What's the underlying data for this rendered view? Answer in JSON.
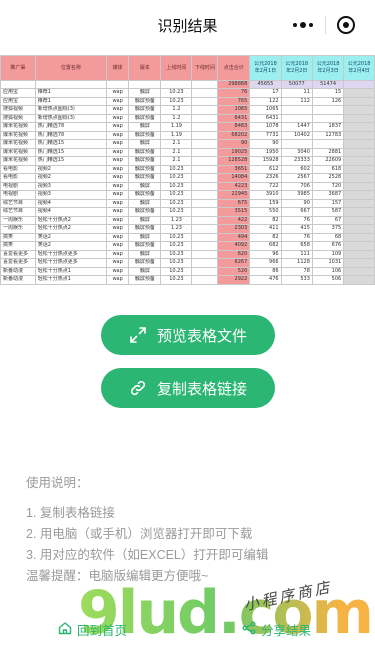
{
  "nav": {
    "title": "识别结果"
  },
  "sheet": {
    "headers": [
      "推广渠",
      "位置名称",
      "媒体",
      "版本",
      "上线时间",
      "下线时间",
      "点击合计",
      "公元2018年2月1日",
      "公元2018年2月2日",
      "公元2018年2月3日",
      "公元2018年2月4日"
    ],
    "totals": [
      "",
      "",
      "",
      "",
      "",
      "",
      "298868",
      "45655",
      "50077",
      "51474",
      ""
    ],
    "rows": [
      [
        "应用宝",
        "推荐1",
        "wap",
        "触屏",
        "10.23",
        "",
        "76",
        "17",
        "11",
        "15",
        ""
      ],
      [
        "应用宝",
        "推荐1",
        "wap",
        "触屏预备",
        "10.23",
        "",
        "765",
        "122",
        "112",
        "126",
        ""
      ],
      [
        "搜狐视频",
        "新增热点图标(3)",
        "wap",
        "触屏预备",
        "1.2",
        "",
        "1065",
        "1065",
        "",
        "",
        ""
      ],
      [
        "搜狐视频",
        "新增热点图标(3)",
        "wap",
        "触屏预备",
        "1.2",
        "",
        "6431",
        "6431",
        "",
        "",
        ""
      ],
      [
        "爆米花视频",
        "热门精选78",
        "wap",
        "触屏",
        "1.19",
        "",
        "8483",
        "1078",
        "1447",
        "1837",
        ""
      ],
      [
        "爆米花视频",
        "热门精选78",
        "wap",
        "触屏预备",
        "1.19",
        "",
        "68202",
        "7731",
        "10402",
        "12783",
        ""
      ],
      [
        "爆米花视频",
        "热门精选15",
        "wap",
        "触屏",
        "2.1",
        "",
        "90",
        "90",
        "",
        "",
        ""
      ],
      [
        "爆米花视频",
        "热门精选15",
        "wap",
        "触屏预备",
        "2.1",
        "",
        "19025",
        "1950",
        "3040",
        "2881",
        ""
      ],
      [
        "爆米花视频",
        "热门精选15",
        "wap",
        "触屏预备",
        "2.1",
        "",
        "128528",
        "15928",
        "23333",
        "22609",
        ""
      ],
      [
        "看电影",
        "视频2",
        "wap",
        "触屏预备",
        "10.23",
        "",
        "3651",
        "612",
        "602",
        "618",
        ""
      ],
      [
        "看电影",
        "视频2",
        "wap",
        "触屏预备",
        "10.23",
        "",
        "14084",
        "2326",
        "2567",
        "2528",
        ""
      ],
      [
        "电视剧",
        "视频3",
        "wap",
        "触屏",
        "10.23",
        "",
        "4223",
        "722",
        "706",
        "720",
        ""
      ],
      [
        "电视剧",
        "视频3",
        "wap",
        "触屏预备",
        "10.23",
        "",
        "22945",
        "3910",
        "3985",
        "3687",
        ""
      ],
      [
        "综艺节目",
        "视频4",
        "wap",
        "触屏",
        "10.23",
        "",
        "675",
        "159",
        "90",
        "157",
        ""
      ],
      [
        "综艺节目",
        "视频4",
        "wap",
        "触屏预备",
        "10.23",
        "",
        "3515",
        "550",
        "667",
        "587",
        ""
      ],
      [
        "一周娱乐",
        "轻松十分热点2",
        "wap",
        "触屏",
        "1.23",
        "",
        "422",
        "82",
        "76",
        "67",
        ""
      ],
      [
        "一周娱乐",
        "轻松十分热点2",
        "wap",
        "触屏预备",
        "1.23",
        "",
        "2303",
        "411",
        "415",
        "375",
        ""
      ],
      [
        "搞笑",
        "笑话2",
        "wap",
        "触屏",
        "10.23",
        "",
        "494",
        "82",
        "76",
        "68",
        ""
      ],
      [
        "搞笑",
        "笑话2",
        "wap",
        "触屏预备",
        "10.23",
        "",
        "4092",
        "682",
        "658",
        "676",
        ""
      ],
      [
        "喜爱看更多",
        "轻松十分热点更多",
        "wap",
        "触屏",
        "10.23",
        "",
        "620",
        "96",
        "111",
        "109",
        ""
      ],
      [
        "喜爱看更多",
        "轻松十分热点更多",
        "wap",
        "触屏预备",
        "10.23",
        "",
        "6267",
        "966",
        "1128",
        "1031",
        ""
      ],
      [
        "新番动漫",
        "轻松十分热点1",
        "wap",
        "触屏",
        "10.23",
        "",
        "520",
        "86",
        "78",
        "106",
        ""
      ],
      [
        "新番动漫",
        "轻松十分热点1",
        "wap",
        "触屏预备",
        "10.23",
        "",
        "2922",
        "476",
        "533",
        "506",
        ""
      ]
    ]
  },
  "buttons": {
    "preview_label": "预览表格文件",
    "copy_label": "复制表格链接"
  },
  "instructions": {
    "heading": "使用说明：",
    "steps": [
      "1. 复制表格链接",
      "2. 用电脑（或手机）浏览器打开即可下载",
      "3. 用对应的软件（如EXCEL）打开即可编辑",
      "温馨提醒：电脑版编辑更方便哦~"
    ]
  },
  "bottom": {
    "home_label": "回到首页",
    "share_label": "分享结果"
  },
  "watermark": {
    "logo": "9lud.com",
    "tagline": "小程序商店"
  },
  "colors": {
    "accent": "#2bb673",
    "header_pink": "#f39a9a",
    "header_cyan": "#9bf0ef"
  },
  "icons": [
    "more-dots-icon",
    "target-icon",
    "expand-arrows-icon",
    "link-icon",
    "home-icon",
    "share-icon"
  ]
}
